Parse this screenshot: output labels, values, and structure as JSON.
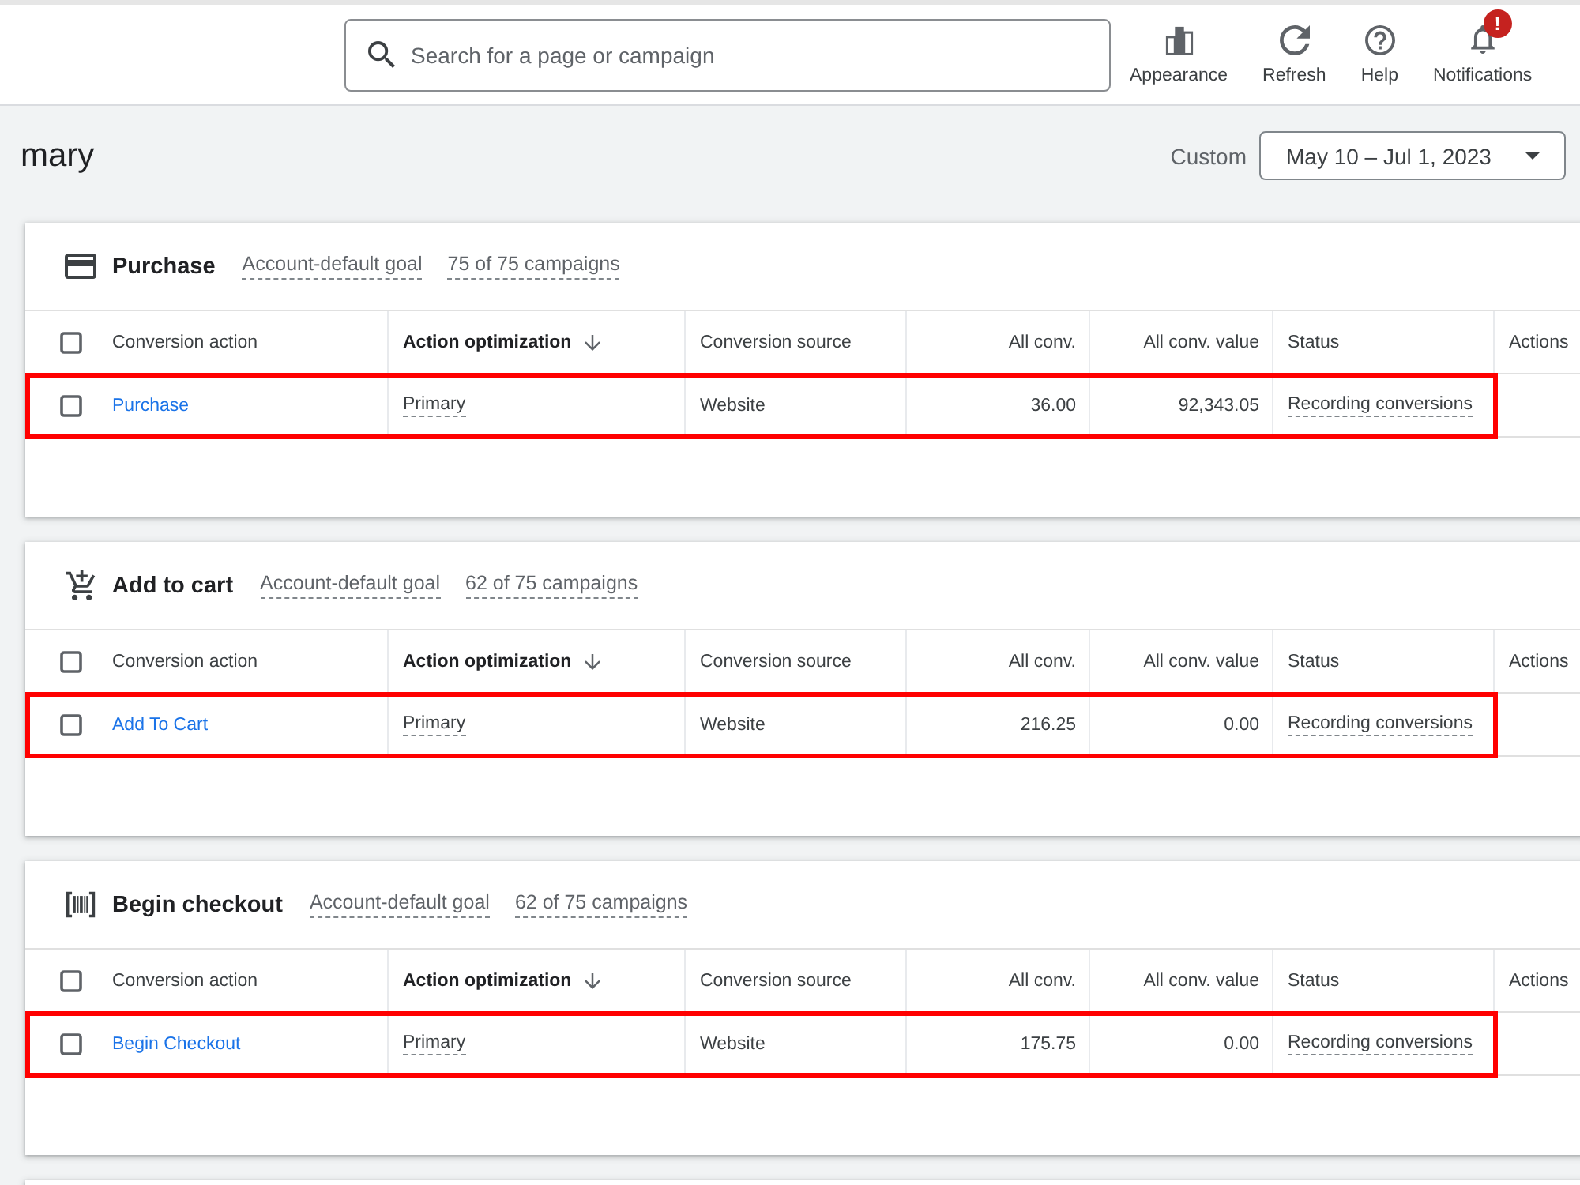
{
  "top_bar": {
    "search": {
      "placeholder": "Search for a page or campaign"
    },
    "actions": [
      {
        "kind": "appearance",
        "label": "Appearance"
      },
      {
        "kind": "refresh",
        "label": "Refresh"
      },
      {
        "kind": "help",
        "label": "Help"
      },
      {
        "kind": "notifications",
        "label": "Notifications",
        "badge": "!"
      }
    ]
  },
  "page_header": {
    "title": "mary",
    "date_range": {
      "label": "Custom",
      "value": "May 10 – Jul 1, 2023"
    }
  },
  "goals": [
    {
      "kind": "purchase",
      "title": "Purchase",
      "goal_type": "Account-default goal",
      "campaigns": "75 of 75 campaigns",
      "table": {
        "select_all_checked": false,
        "columns": [
          {
            "label": "Conversion action",
            "sorted": false
          },
          {
            "label": "Action optimization",
            "sorted": true
          },
          {
            "label": "Conversion source",
            "sorted": false
          },
          {
            "label": "All conv.",
            "sorted": false
          },
          {
            "label": "All conv. value",
            "sorted": false
          },
          {
            "label": "Status",
            "sorted": false
          },
          {
            "label": "Actions",
            "sorted": false
          }
        ],
        "rows": [
          {
            "checked": false,
            "highlighted": true,
            "cells": [
              "Purchase",
              "Primary",
              "Website",
              "36.00",
              "92,343.05",
              "Recording conversions"
            ]
          }
        ]
      }
    },
    {
      "kind": "add_to_cart",
      "title": "Add to cart",
      "goal_type": "Account-default goal",
      "campaigns": "62 of 75 campaigns",
      "table": {
        "select_all_checked": false,
        "columns": [
          {
            "label": "Conversion action",
            "sorted": false
          },
          {
            "label": "Action optimization",
            "sorted": true
          },
          {
            "label": "Conversion source",
            "sorted": false
          },
          {
            "label": "All conv.",
            "sorted": false
          },
          {
            "label": "All conv. value",
            "sorted": false
          },
          {
            "label": "Status",
            "sorted": false
          },
          {
            "label": "Actions",
            "sorted": false
          }
        ],
        "rows": [
          {
            "checked": false,
            "highlighted": true,
            "cells": [
              "Add To Cart",
              "Primary",
              "Website",
              "216.25",
              "0.00",
              "Recording conversions"
            ]
          }
        ]
      }
    },
    {
      "kind": "begin_checkout",
      "title": "Begin checkout",
      "goal_type": "Account-default goal",
      "campaigns": "62 of 75 campaigns",
      "table": {
        "select_all_checked": false,
        "columns": [
          {
            "label": "Conversion action",
            "sorted": false
          },
          {
            "label": "Action optimization",
            "sorted": true
          },
          {
            "label": "Conversion source",
            "sorted": false
          },
          {
            "label": "All conv.",
            "sorted": false
          },
          {
            "label": "All conv. value",
            "sorted": false
          },
          {
            "label": "Status",
            "sorted": false
          },
          {
            "label": "Actions",
            "sorted": false
          }
        ],
        "rows": [
          {
            "checked": false,
            "highlighted": true,
            "cells": [
              "Begin Checkout",
              "Primary",
              "Website",
              "175.75",
              "0.00",
              "Recording conversions"
            ]
          }
        ]
      }
    }
  ]
}
